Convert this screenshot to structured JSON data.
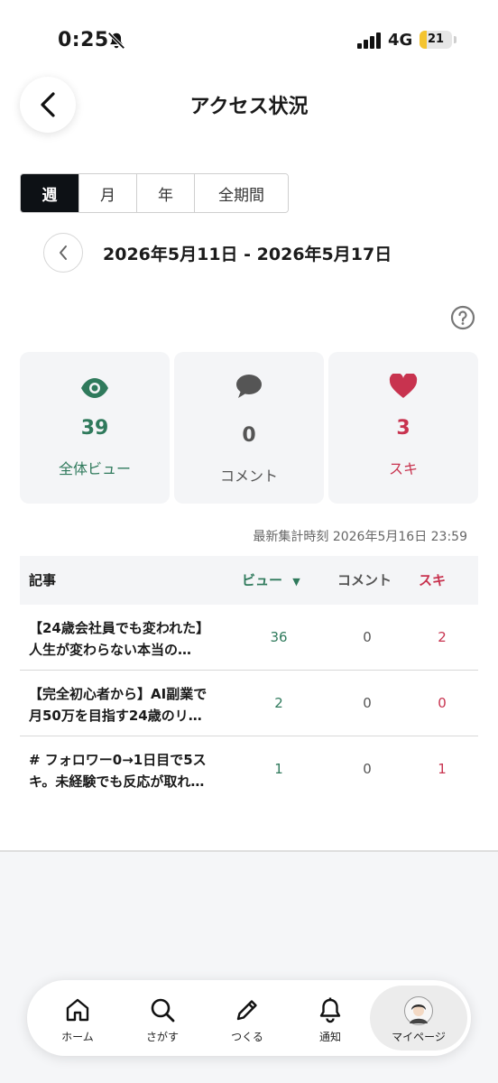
{
  "status_bar": {
    "time": "0:25",
    "network": "4G",
    "battery": "21",
    "battery_level": 0.21
  },
  "header": {
    "title": "アクセス状況"
  },
  "period_tabs": [
    {
      "label": "週",
      "active": true
    },
    {
      "label": "月",
      "active": false
    },
    {
      "label": "年",
      "active": false
    },
    {
      "label": "全期間",
      "active": false
    }
  ],
  "date_range": "2026年5月11日 - 2026年5月17日",
  "stats": {
    "views": {
      "value": "39",
      "label": "全体ビュー",
      "color": "#2f7a5c"
    },
    "comments": {
      "value": "0",
      "label": "コメント",
      "color": "#555555"
    },
    "likes": {
      "value": "3",
      "label": "スキ",
      "color": "#c8334f"
    }
  },
  "last_updated": "最新集計時刻 2026年5月16日 23:59",
  "table": {
    "headers": {
      "article": "記事",
      "views": "ビュー",
      "comments": "コメント",
      "likes": "スキ"
    },
    "sort_indicator": "▼",
    "rows": [
      {
        "title_line1": "【24歳会社員でも変われた】",
        "title_line2": "人生が変わらない本当の…",
        "views": "36",
        "comments": "0",
        "likes": "2"
      },
      {
        "title_line1": "【完全初心者から】AI副業で",
        "title_line2": "月50万を目指す24歳のリ…",
        "views": "2",
        "comments": "0",
        "likes": "0"
      },
      {
        "title_line1": "# フォロワー0→1日目で5ス",
        "title_line2": "キ。未経験でも反応が取れ…",
        "views": "1",
        "comments": "0",
        "likes": "1"
      }
    ]
  },
  "bottom_nav": [
    {
      "label": "ホーム",
      "icon": "home-icon"
    },
    {
      "label": "さがす",
      "icon": "search-icon"
    },
    {
      "label": "つくる",
      "icon": "pencil-icon"
    },
    {
      "label": "通知",
      "icon": "bell-icon"
    },
    {
      "label": "マイページ",
      "icon": "avatar",
      "active": true
    }
  ]
}
